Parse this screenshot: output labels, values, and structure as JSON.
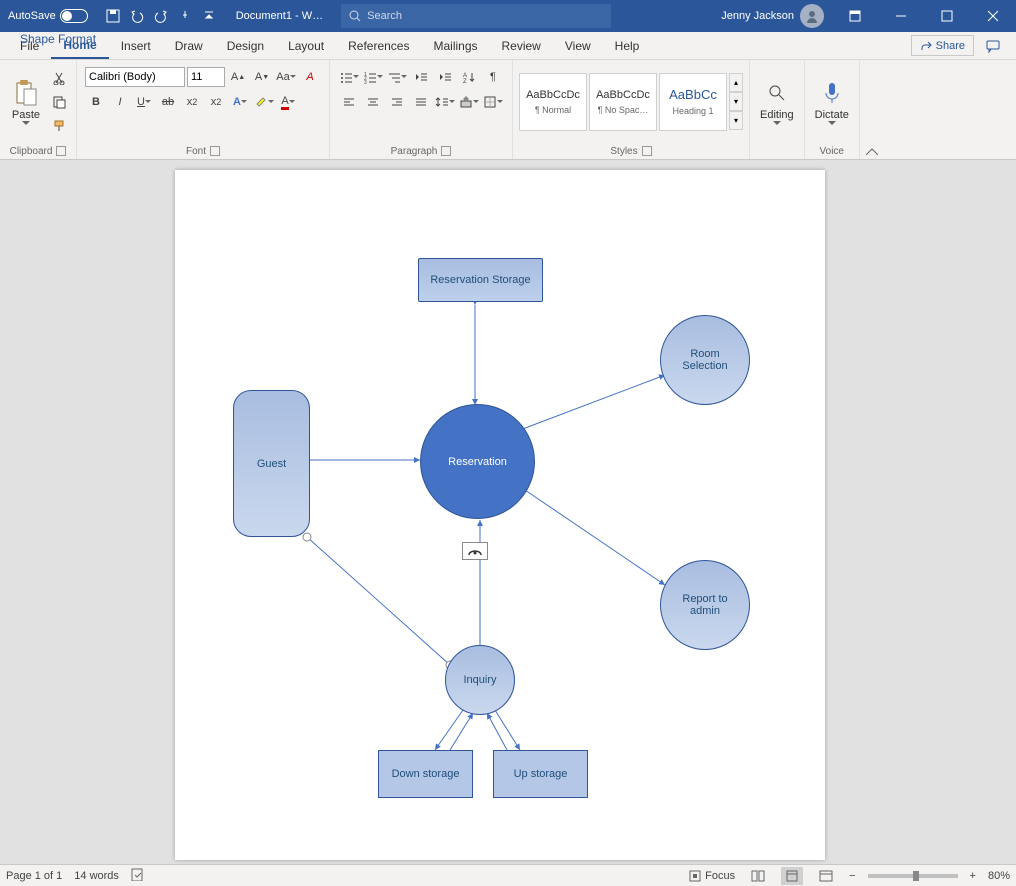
{
  "titlebar": {
    "autosave": "AutoSave",
    "doc_title": "Document1 - W…",
    "search_placeholder": "Search",
    "user_name": "Jenny Jackson"
  },
  "tabs": {
    "file": "File",
    "home": "Home",
    "insert": "Insert",
    "draw": "Draw",
    "design": "Design",
    "layout": "Layout",
    "references": "References",
    "mailings": "Mailings",
    "review": "Review",
    "view": "View",
    "help": "Help",
    "shape_format": "Shape Format",
    "share": "Share"
  },
  "ribbon": {
    "clipboard": {
      "paste": "Paste",
      "label": "Clipboard"
    },
    "font": {
      "name": "Calibri (Body)",
      "size": "11",
      "label": "Font"
    },
    "paragraph": {
      "label": "Paragraph"
    },
    "styles": {
      "label": "Styles",
      "preview": "AaBbCcDc",
      "preview_h": "AaBbCc",
      "s1": "¶ Normal",
      "s2": "¶ No Spac…",
      "s3": "Heading 1"
    },
    "editing": {
      "label": "Editing"
    },
    "voice": {
      "dictate": "Dictate",
      "label": "Voice"
    }
  },
  "diagram": {
    "reservation_storage": "Reservation Storage",
    "room_selection": "Room\nSelection",
    "guest": "Guest",
    "reservation": "Reservation",
    "report_to_admin": "Report to\nadmin",
    "inquiry": "Inquiry",
    "down_storage": "Down storage",
    "up_storage": "Up storage"
  },
  "statusbar": {
    "page": "Page 1 of 1",
    "words": "14 words",
    "focus": "Focus",
    "zoom": "80%"
  }
}
